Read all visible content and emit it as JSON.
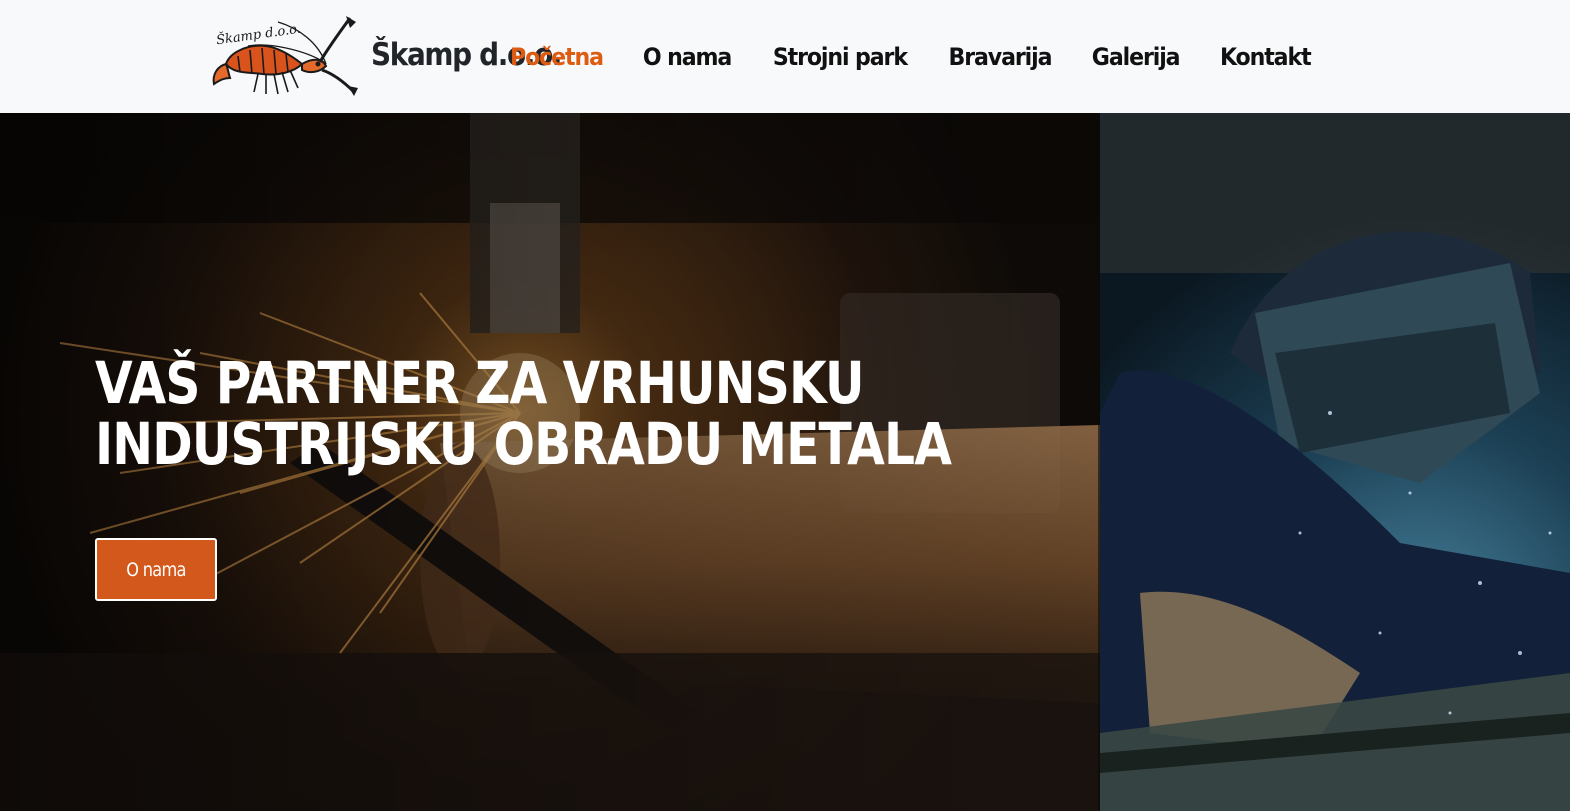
{
  "brand": {
    "name": "Škamp d.o.o.",
    "logo_text": "Škamp d.o.o."
  },
  "nav": {
    "items": [
      {
        "label": "Početna",
        "active": true
      },
      {
        "label": "O nama",
        "active": false
      },
      {
        "label": "Strojni park",
        "active": false
      },
      {
        "label": "Bravarija",
        "active": false
      },
      {
        "label": "Galerija",
        "active": false
      },
      {
        "label": "Kontakt",
        "active": false
      }
    ]
  },
  "hero": {
    "title_line1": "Vaš partner za vrhunsku",
    "title_line2": "industrijsku obradu metala",
    "button_label": "O nama"
  },
  "colors": {
    "accent": "#dd5c12",
    "button": "#d3581b",
    "nav_bg": "#f8f9fb",
    "nav_text": "#111111"
  }
}
